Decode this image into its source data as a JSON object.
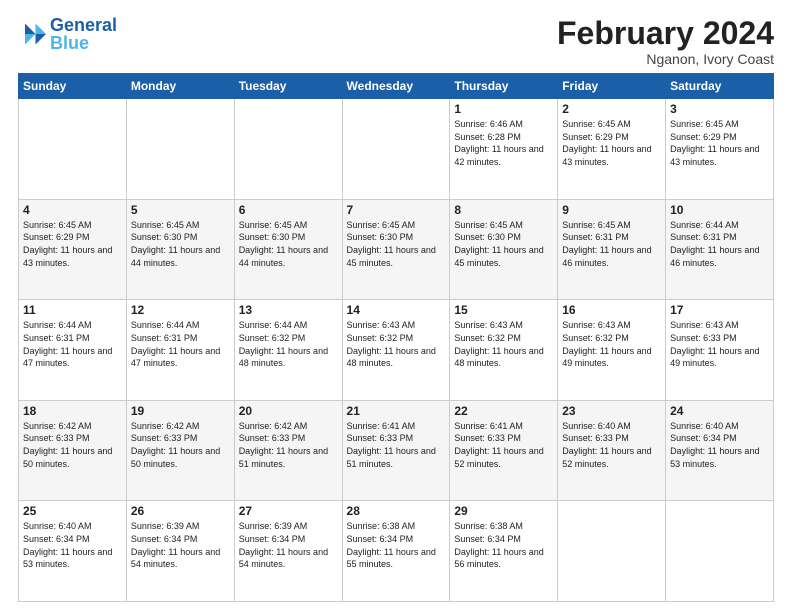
{
  "logo": {
    "text_general": "General",
    "text_blue": "Blue"
  },
  "title": "February 2024",
  "subtitle": "Nganon, Ivory Coast",
  "header_days": [
    "Sunday",
    "Monday",
    "Tuesday",
    "Wednesday",
    "Thursday",
    "Friday",
    "Saturday"
  ],
  "weeks": [
    [
      {
        "day": "",
        "info": ""
      },
      {
        "day": "",
        "info": ""
      },
      {
        "day": "",
        "info": ""
      },
      {
        "day": "",
        "info": ""
      },
      {
        "day": "1",
        "info": "Sunrise: 6:46 AM\nSunset: 6:28 PM\nDaylight: 11 hours\nand 42 minutes."
      },
      {
        "day": "2",
        "info": "Sunrise: 6:45 AM\nSunset: 6:29 PM\nDaylight: 11 hours\nand 43 minutes."
      },
      {
        "day": "3",
        "info": "Sunrise: 6:45 AM\nSunset: 6:29 PM\nDaylight: 11 hours\nand 43 minutes."
      }
    ],
    [
      {
        "day": "4",
        "info": "Sunrise: 6:45 AM\nSunset: 6:29 PM\nDaylight: 11 hours\nand 43 minutes."
      },
      {
        "day": "5",
        "info": "Sunrise: 6:45 AM\nSunset: 6:30 PM\nDaylight: 11 hours\nand 44 minutes."
      },
      {
        "day": "6",
        "info": "Sunrise: 6:45 AM\nSunset: 6:30 PM\nDaylight: 11 hours\nand 44 minutes."
      },
      {
        "day": "7",
        "info": "Sunrise: 6:45 AM\nSunset: 6:30 PM\nDaylight: 11 hours\nand 45 minutes."
      },
      {
        "day": "8",
        "info": "Sunrise: 6:45 AM\nSunset: 6:30 PM\nDaylight: 11 hours\nand 45 minutes."
      },
      {
        "day": "9",
        "info": "Sunrise: 6:45 AM\nSunset: 6:31 PM\nDaylight: 11 hours\nand 46 minutes."
      },
      {
        "day": "10",
        "info": "Sunrise: 6:44 AM\nSunset: 6:31 PM\nDaylight: 11 hours\nand 46 minutes."
      }
    ],
    [
      {
        "day": "11",
        "info": "Sunrise: 6:44 AM\nSunset: 6:31 PM\nDaylight: 11 hours\nand 47 minutes."
      },
      {
        "day": "12",
        "info": "Sunrise: 6:44 AM\nSunset: 6:31 PM\nDaylight: 11 hours\nand 47 minutes."
      },
      {
        "day": "13",
        "info": "Sunrise: 6:44 AM\nSunset: 6:32 PM\nDaylight: 11 hours\nand 48 minutes."
      },
      {
        "day": "14",
        "info": "Sunrise: 6:43 AM\nSunset: 6:32 PM\nDaylight: 11 hours\nand 48 minutes."
      },
      {
        "day": "15",
        "info": "Sunrise: 6:43 AM\nSunset: 6:32 PM\nDaylight: 11 hours\nand 48 minutes."
      },
      {
        "day": "16",
        "info": "Sunrise: 6:43 AM\nSunset: 6:32 PM\nDaylight: 11 hours\nand 49 minutes."
      },
      {
        "day": "17",
        "info": "Sunrise: 6:43 AM\nSunset: 6:33 PM\nDaylight: 11 hours\nand 49 minutes."
      }
    ],
    [
      {
        "day": "18",
        "info": "Sunrise: 6:42 AM\nSunset: 6:33 PM\nDaylight: 11 hours\nand 50 minutes."
      },
      {
        "day": "19",
        "info": "Sunrise: 6:42 AM\nSunset: 6:33 PM\nDaylight: 11 hours\nand 50 minutes."
      },
      {
        "day": "20",
        "info": "Sunrise: 6:42 AM\nSunset: 6:33 PM\nDaylight: 11 hours\nand 51 minutes."
      },
      {
        "day": "21",
        "info": "Sunrise: 6:41 AM\nSunset: 6:33 PM\nDaylight: 11 hours\nand 51 minutes."
      },
      {
        "day": "22",
        "info": "Sunrise: 6:41 AM\nSunset: 6:33 PM\nDaylight: 11 hours\nand 52 minutes."
      },
      {
        "day": "23",
        "info": "Sunrise: 6:40 AM\nSunset: 6:33 PM\nDaylight: 11 hours\nand 52 minutes."
      },
      {
        "day": "24",
        "info": "Sunrise: 6:40 AM\nSunset: 6:34 PM\nDaylight: 11 hours\nand 53 minutes."
      }
    ],
    [
      {
        "day": "25",
        "info": "Sunrise: 6:40 AM\nSunset: 6:34 PM\nDaylight: 11 hours\nand 53 minutes."
      },
      {
        "day": "26",
        "info": "Sunrise: 6:39 AM\nSunset: 6:34 PM\nDaylight: 11 hours\nand 54 minutes."
      },
      {
        "day": "27",
        "info": "Sunrise: 6:39 AM\nSunset: 6:34 PM\nDaylight: 11 hours\nand 54 minutes."
      },
      {
        "day": "28",
        "info": "Sunrise: 6:38 AM\nSunset: 6:34 PM\nDaylight: 11 hours\nand 55 minutes."
      },
      {
        "day": "29",
        "info": "Sunrise: 6:38 AM\nSunset: 6:34 PM\nDaylight: 11 hours\nand 56 minutes."
      },
      {
        "day": "",
        "info": ""
      },
      {
        "day": "",
        "info": ""
      }
    ]
  ]
}
